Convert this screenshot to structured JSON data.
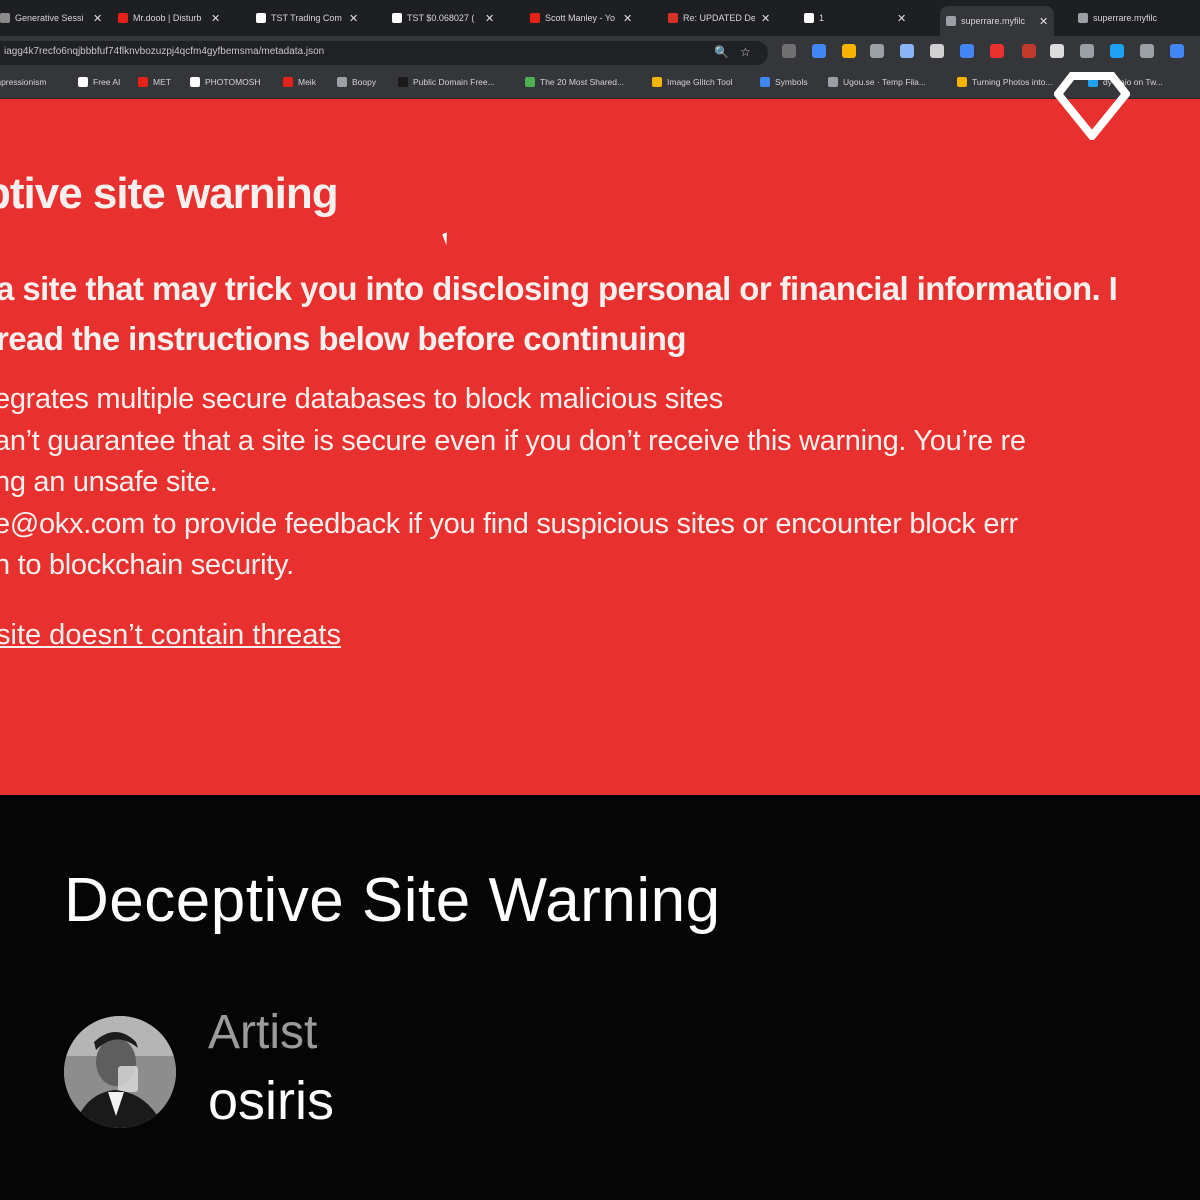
{
  "browser": {
    "tabs": [
      {
        "title": "Generative Sessi",
        "icon": "generic-tab-icon",
        "color": "#8a8a8a"
      },
      {
        "title": "Mr.doob | Disturb",
        "icon": "youtube-icon",
        "color": "#e62117"
      },
      {
        "title": "TST Trading Com",
        "icon": "x-logo-icon",
        "color": "#ffffff"
      },
      {
        "title": "TST $0.068027 (",
        "icon": "x-logo-icon",
        "color": "#ffffff"
      },
      {
        "title": "Scott Manley - Yo",
        "icon": "youtube-icon",
        "color": "#e62117"
      },
      {
        "title": "Re: UPDATED Del",
        "icon": "gmail-icon",
        "color": "#d93025"
      },
      {
        "title": "1",
        "icon": "whatsapp-icon",
        "color": "#ffffff"
      },
      {
        "title": "superrare.myfilc",
        "icon": "globe-icon",
        "color": "#9aa0a6",
        "active": true
      },
      {
        "title": "superrare.myfilc",
        "icon": "globe-icon",
        "color": "#9aa0a6"
      }
    ],
    "url": "iagg4k7recfo6nqjbbbfuf74flknvbozuzpj4qcfm4gyfbemsma/metadata.json",
    "bookmarks": [
      {
        "label": "mpressionism",
        "color": "#9aa0a6"
      },
      {
        "label": "Free AI",
        "color": "#ffffff"
      },
      {
        "label": "MET",
        "color": "#e62117"
      },
      {
        "label": "PHOTOMOSH",
        "color": "#ffffff"
      },
      {
        "label": "Meik",
        "color": "#e62117"
      },
      {
        "label": "Boopy",
        "color": "#9aa0a6"
      },
      {
        "label": "Public Domain Free...",
        "color": "#1a1a1a"
      },
      {
        "label": "The 20 Most Shared...",
        "color": "#4caf50"
      },
      {
        "label": "Image Glitch Tool",
        "color": "#f4b400"
      },
      {
        "label": "Symbols",
        "color": "#4285f4"
      },
      {
        "label": "Ugou.se · Temp Fila...",
        "color": "#9aa0a6"
      },
      {
        "label": "Turning Photos into...",
        "color": "#f4b400"
      },
      {
        "label": "dy Baio on Tw...",
        "color": "#1da1f2"
      }
    ]
  },
  "warning": {
    "title": "ptive site warning",
    "lead_lines": [
      "a site that may trick you into disclosing personal or financial information. I",
      "read the instructions below before continuing"
    ],
    "body_lines": [
      "egrates multiple secure databases to block malicious sites",
      "an’t guarantee that a site is secure even if you don’t receive this warning. You’re re",
      "ng an unsafe site.",
      "e@okx.com to provide feedback if you find suspicious sites or encounter block err",
      "n to blockchain security."
    ],
    "link": "site doesn’t contain threats",
    "background": "#e8302e"
  },
  "caption": {
    "title": "Deceptive Site Warning",
    "role": "Artist",
    "name": "osiris"
  }
}
